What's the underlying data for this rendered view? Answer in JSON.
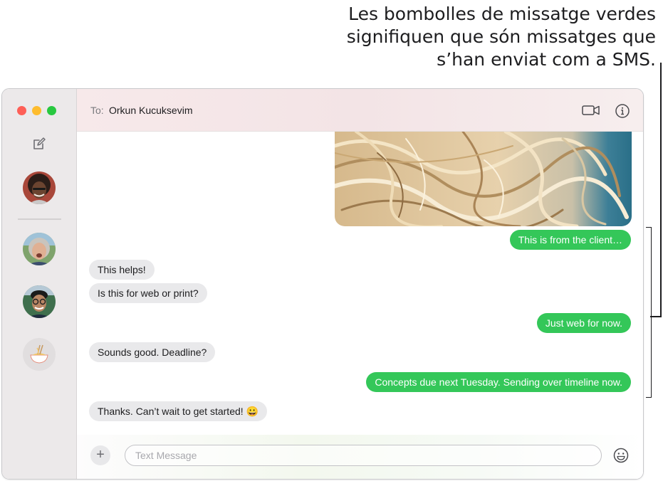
{
  "callout": {
    "line1": "Les bombolles de missatge verdes",
    "line2": "signifiquen que són missatges que",
    "line3": "s’han enviat com a SMS."
  },
  "sidebar": {
    "compose_icon": "compose-icon",
    "conversations": [
      {
        "name": "avatar-man-curly-hair",
        "pinned": true
      },
      {
        "name": "avatar-woman-gray-hair"
      },
      {
        "name": "avatar-man-glasses"
      },
      {
        "name": "avatar-noodles-bowl"
      }
    ]
  },
  "header": {
    "to_label": "To:",
    "recipient": "Orkun Kucuksevim",
    "video_icon": "video-camera-icon",
    "info_icon": "info-icon"
  },
  "messages": [
    {
      "side": "out",
      "text": "This is from the client…"
    },
    {
      "side": "in",
      "text": "This helps!"
    },
    {
      "side": "in",
      "text": "Is this for web or print?"
    },
    {
      "side": "out",
      "text": "Just web for now."
    },
    {
      "side": "in",
      "text": "Sounds good. Deadline?"
    },
    {
      "side": "out",
      "text": "Concepts due next Tuesday. Sending over timeline now."
    },
    {
      "side": "in",
      "text": "Thanks. Can’t wait to get started! 😀"
    }
  ],
  "composer": {
    "placeholder": "Text Message",
    "plus_label": "+"
  },
  "colors": {
    "sms_bubble": "#34c759",
    "received_bubble": "#e9e9eb"
  }
}
